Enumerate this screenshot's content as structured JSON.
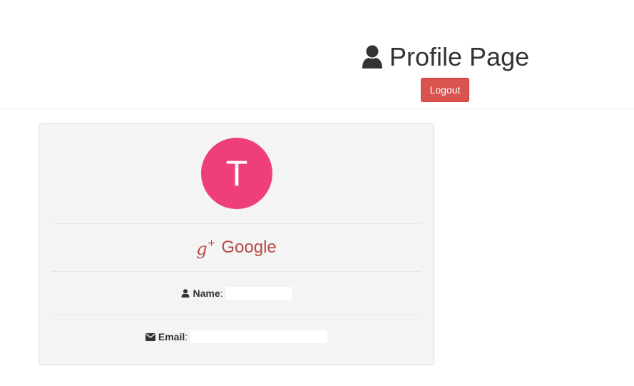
{
  "header": {
    "title": "Profile Page",
    "title_icon": "user-icon",
    "logout_label": "Logout"
  },
  "profile": {
    "avatar_letter": "T",
    "avatar_color": "#ef3f7a",
    "provider": {
      "icon": "google-plus-icon",
      "icon_text": "g",
      "icon_sup": "+",
      "label": "Google",
      "color": "#b94a48"
    },
    "name": {
      "icon": "user-icon",
      "label": "Name",
      "separator": ":",
      "value": ""
    },
    "email": {
      "icon": "envelope-icon",
      "label": "Email",
      "separator": ":",
      "value": ""
    }
  },
  "colors": {
    "logout_button": "#d9534f",
    "card_background": "#f4f4f4"
  }
}
